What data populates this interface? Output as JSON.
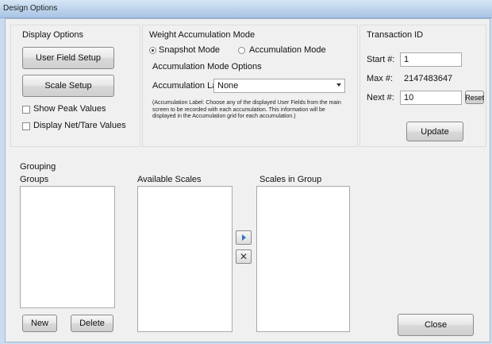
{
  "window": {
    "title": "Design Options"
  },
  "display_options": {
    "title": "Display Options",
    "user_field_setup_label": "User Field Setup",
    "scale_setup_label": "Scale Setup",
    "show_peak_values_label": "Show Peak Values",
    "display_net_tare_label": "Display Net/Tare Values",
    "show_peak_values_checked": false,
    "display_net_tare_checked": false
  },
  "weight_accumulation": {
    "title": "Weight Accumulation Mode",
    "snapshot_label": "Snapshot Mode",
    "accumulation_label": "Accumulation Mode",
    "selected_mode": "Snapshot Mode",
    "options_title": "Accumulation Mode Options",
    "accum_label_caption": "Accumulation Label:",
    "accum_label_value": "None",
    "note": "(Accumulation Label:  Choose any of the displayed User Fields from the main screen to be recorded with each accumulation. This information will be displayed in the Accumulation grid for each accumulation.)"
  },
  "transaction_id": {
    "title": "Transaction ID",
    "start_label": "Start #:",
    "start_value": "1",
    "max_label": "Max #:",
    "max_value": "2147483647",
    "next_label": "Next #:",
    "next_value": "10",
    "reset_label": "Reset",
    "update_label": "Update"
  },
  "grouping": {
    "title": "Grouping",
    "groups_label": "Groups",
    "available_scales_label": "Available Scales",
    "scales_in_group_label": "Scales in Group",
    "new_label": "New",
    "delete_label": "Delete",
    "add_icon": "arrow-right-icon",
    "remove_icon": "x-icon"
  },
  "footer": {
    "close_label": "Close"
  }
}
